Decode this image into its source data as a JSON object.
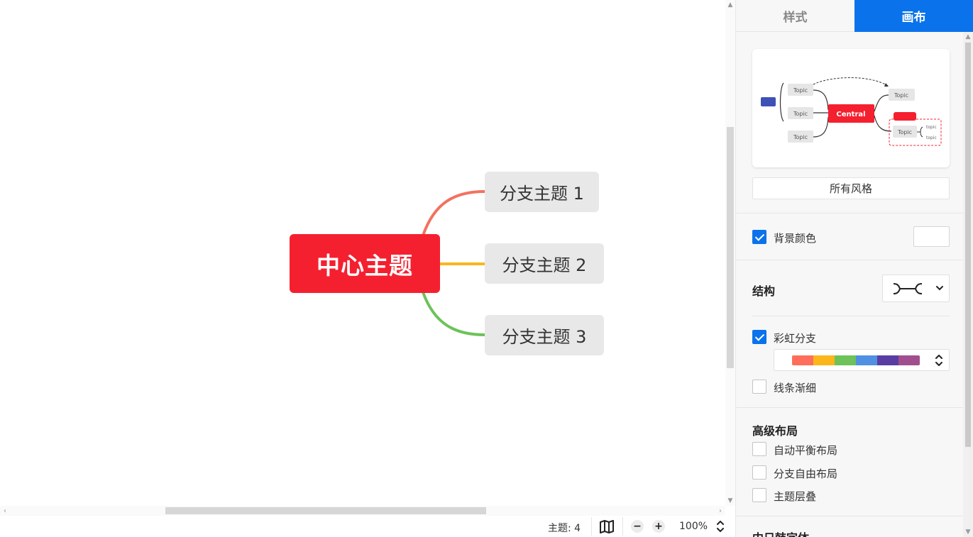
{
  "mindmap": {
    "central_topic": "中心主题",
    "branches": [
      {
        "label": "分支主题 1",
        "color": "#f27260"
      },
      {
        "label": "分支主题 2",
        "color": "#fbb61b"
      },
      {
        "label": "分支主题 3",
        "color": "#6dc259"
      }
    ],
    "central_color": "#f5202f"
  },
  "statusbar": {
    "topic_count": "主题: 4",
    "zoom": "100%",
    "zoom_out_label": "−",
    "zoom_in_label": "+"
  },
  "sidebar": {
    "tabs": [
      {
        "label": "样式",
        "active": false
      },
      {
        "label": "画布",
        "active": true
      }
    ],
    "preview": {
      "central_label": "Central",
      "topic_label": "Topic",
      "subtopic_label": "topic"
    },
    "all_styles_label": "所有风格",
    "background_color": {
      "label": "背景颜色",
      "checked": true,
      "value": "#ffffff"
    },
    "structure": {
      "title": "结构"
    },
    "rainbow_branch": {
      "label": "彩虹分支",
      "checked": true,
      "colors": [
        "#ff6e5b",
        "#fbb61b",
        "#6dc259",
        "#4f90e2",
        "#5a3da3",
        "#a14e8e"
      ]
    },
    "line_taper": {
      "label": "线条渐细",
      "checked": false
    },
    "advanced_layout": {
      "title": "高级布局",
      "options": [
        {
          "label": "自动平衡布局",
          "checked": false
        },
        {
          "label": "分支自由布局",
          "checked": false
        },
        {
          "label": "主题层叠",
          "checked": false
        }
      ]
    },
    "cjk_font": {
      "title": "中日韩字体"
    }
  },
  "icons": {
    "map": "map-icon",
    "stepper": "up-down-chevron-icon",
    "structure": "mindmap-structure-icon",
    "dropdown": "chevron-down-icon"
  },
  "accent_color": "#0a73eb"
}
